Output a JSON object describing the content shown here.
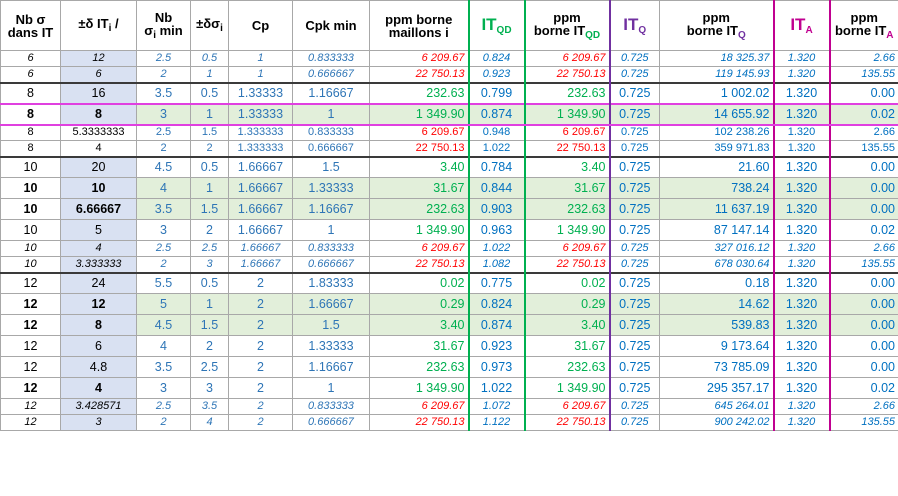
{
  "headers": {
    "nb_sigma": [
      "Nb σ",
      "dans IT"
    ],
    "dit": "±δ IT",
    "dit_sub": "i",
    "dit_suffix": " /",
    "nb_sigma_min": [
      "Nb",
      "σ",
      "i",
      " min"
    ],
    "dsigma": "±δσ",
    "dsigma_sub": "i",
    "cp": "Cp",
    "cpk": "Cpk min",
    "ppm_borne": [
      "ppm borne",
      "maillons i"
    ],
    "itqd": "IT",
    "itqd_sub": "QD",
    "ppm_itqd": [
      "ppm",
      "borne IT",
      "QD"
    ],
    "itq": "IT",
    "itq_sub": "Q",
    "ppm_itq": [
      "ppm",
      "borne IT",
      "Q"
    ],
    "ita": "IT",
    "ita_sub": "A",
    "ppm_ita": [
      "ppm",
      "borne IT",
      "A"
    ]
  },
  "rows": [
    [
      "6",
      "12",
      "2.5",
      "0.5",
      "1",
      "0.833333",
      "6 209.67",
      "0.824",
      "6 209.67",
      "0.725",
      "18 325.37",
      "1.320",
      "2.66"
    ],
    [
      "6",
      "6",
      "2",
      "1",
      "1",
      "0.666667",
      "22 750.13",
      "0.923",
      "22 750.13",
      "0.725",
      "119 145.93",
      "1.320",
      "135.55"
    ],
    [
      "8",
      "16",
      "3.5",
      "0.5",
      "1.33333",
      "1.16667",
      "232.63",
      "0.799",
      "232.63",
      "0.725",
      "1 002.02",
      "1.320",
      "0.00"
    ],
    [
      "8",
      "8",
      "3",
      "1",
      "1.33333",
      "1",
      "1 349.90",
      "0.874",
      "1 349.90",
      "0.725",
      "14 655.92",
      "1.320",
      "0.02"
    ],
    [
      "8",
      "5.3333333",
      "2.5",
      "1.5",
      "1.333333",
      "0.833333",
      "6 209.67",
      "0.948",
      "6 209.67",
      "0.725",
      "102 238.26",
      "1.320",
      "2.66"
    ],
    [
      "8",
      "4",
      "2",
      "2",
      "1.333333",
      "0.666667",
      "22 750.13",
      "1.022",
      "22 750.13",
      "0.725",
      "359 971.83",
      "1.320",
      "135.55"
    ],
    [
      "10",
      "20",
      "4.5",
      "0.5",
      "1.66667",
      "1.5",
      "3.40",
      "0.784",
      "3.40",
      "0.725",
      "21.60",
      "1.320",
      "0.00"
    ],
    [
      "10",
      "10",
      "4",
      "1",
      "1.66667",
      "1.33333",
      "31.67",
      "0.844",
      "31.67",
      "0.725",
      "738.24",
      "1.320",
      "0.00"
    ],
    [
      "10",
      "6.66667",
      "3.5",
      "1.5",
      "1.66667",
      "1.16667",
      "232.63",
      "0.903",
      "232.63",
      "0.725",
      "11 637.19",
      "1.320",
      "0.00"
    ],
    [
      "10",
      "5",
      "3",
      "2",
      "1.66667",
      "1",
      "1 349.90",
      "0.963",
      "1 349.90",
      "0.725",
      "87 147.14",
      "1.320",
      "0.02"
    ],
    [
      "10",
      "4",
      "2.5",
      "2.5",
      "1.66667",
      "0.833333",
      "6 209.67",
      "1.022",
      "6 209.67",
      "0.725",
      "327 016.12",
      "1.320",
      "2.66"
    ],
    [
      "10",
      "3.333333",
      "2",
      "3",
      "1.66667",
      "0.666667",
      "22 750.13",
      "1.082",
      "22 750.13",
      "0.725",
      "678 030.64",
      "1.320",
      "135.55"
    ],
    [
      "12",
      "24",
      "5.5",
      "0.5",
      "2",
      "1.83333",
      "0.02",
      "0.775",
      "0.02",
      "0.725",
      "0.18",
      "1.320",
      "0.00"
    ],
    [
      "12",
      "12",
      "5",
      "1",
      "2",
      "1.66667",
      "0.29",
      "0.824",
      "0.29",
      "0.725",
      "14.62",
      "1.320",
      "0.00"
    ],
    [
      "12",
      "8",
      "4.5",
      "1.5",
      "2",
      "1.5",
      "3.40",
      "0.874",
      "3.40",
      "0.725",
      "539.83",
      "1.320",
      "0.00"
    ],
    [
      "12",
      "6",
      "4",
      "2",
      "2",
      "1.33333",
      "31.67",
      "0.923",
      "31.67",
      "0.725",
      "9 173.64",
      "1.320",
      "0.00"
    ],
    [
      "12",
      "4.8",
      "3.5",
      "2.5",
      "2",
      "1.16667",
      "232.63",
      "0.973",
      "232.63",
      "0.725",
      "73 785.09",
      "1.320",
      "0.00"
    ],
    [
      "12",
      "4",
      "3",
      "3",
      "2",
      "1",
      "1 349.90",
      "1.022",
      "1 349.90",
      "0.725",
      "295 357.17",
      "1.320",
      "0.02"
    ],
    [
      "12",
      "3.428571",
      "2.5",
      "3.5",
      "2",
      "0.833333",
      "6 209.67",
      "1.072",
      "6 209.67",
      "0.725",
      "645 264.01",
      "1.320",
      "2.66"
    ],
    [
      "12",
      "3",
      "2",
      "4",
      "2",
      "0.666667",
      "22 750.13",
      "1.122",
      "22 750.13",
      "0.725",
      "900 242.02",
      "1.320",
      "135.55"
    ]
  ]
}
